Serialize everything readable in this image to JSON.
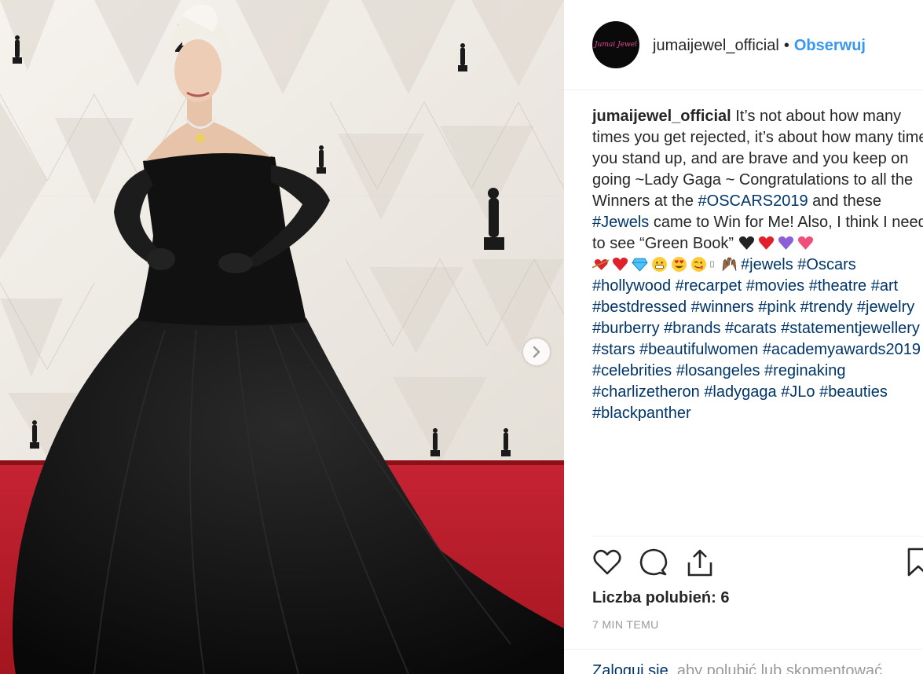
{
  "post": {
    "username": "jumaijewel_official",
    "separator": "•",
    "follow_label": "Obserwuj",
    "avatar_text": "Jumai Jewel"
  },
  "caption": {
    "user": "jumaijewel_official",
    "text_1": " It’s not about how many times you get rejected, it’s about how many times you stand up, and are brave and you keep on going ~Lady Gaga ~ Congratulations to all the Winners at the ",
    "tag_oscars2019": "#OSCARS2019",
    "text_2": " and these ",
    "tag_jewels": "#Jewels",
    "text_3": " came to Win for Me! Also, I think I need to see “Green Book” ",
    "emoji_1": [
      "black-heart-icon",
      "red-heart-icon",
      "purple-heart-icon",
      "sparkling-heart-icon"
    ],
    "emoji_2": [
      "heart-with-arrow-icon",
      "red-heart-icon",
      "gem-icon",
      "grinning-face-icon",
      "heart-eyes-face-icon",
      "face-savoring-food-icon",
      "missing-glyph-icon",
      "raised-hands-icon"
    ],
    "hashtags": [
      "#jewels",
      "#Oscars",
      "#hollywood",
      "#recarpet",
      "#movies",
      "#theatre",
      "#art",
      "#bestdressed",
      "#winners",
      "#pink",
      "#trendy",
      "#jewelry",
      "#burberry",
      "#brands",
      "#carats",
      "#statementjewellery",
      "#stars",
      "#beautifulwomen",
      "#academyawards2019",
      "#celebrities",
      "#losangeles",
      "#reginaking",
      "#charlizetheron",
      "#ladygaga",
      "#JLo",
      "#beauties",
      "#blackpanther"
    ]
  },
  "actions": {
    "like_icon": "heart-outline-icon",
    "comment_icon": "comment-bubble-icon",
    "share_icon": "share-upload-icon",
    "save_icon": "bookmark-icon"
  },
  "likes_label": "Liczba polubień: 6",
  "timestamp": "7 MIN TEMU",
  "login": {
    "link": "Zaloguj się",
    "rest": ", aby polubić lub skomentować."
  },
  "colors": {
    "link_blue": "#3897f0",
    "hashtag": "#003569",
    "muted": "#999999",
    "carpet": "#b81e2a"
  }
}
